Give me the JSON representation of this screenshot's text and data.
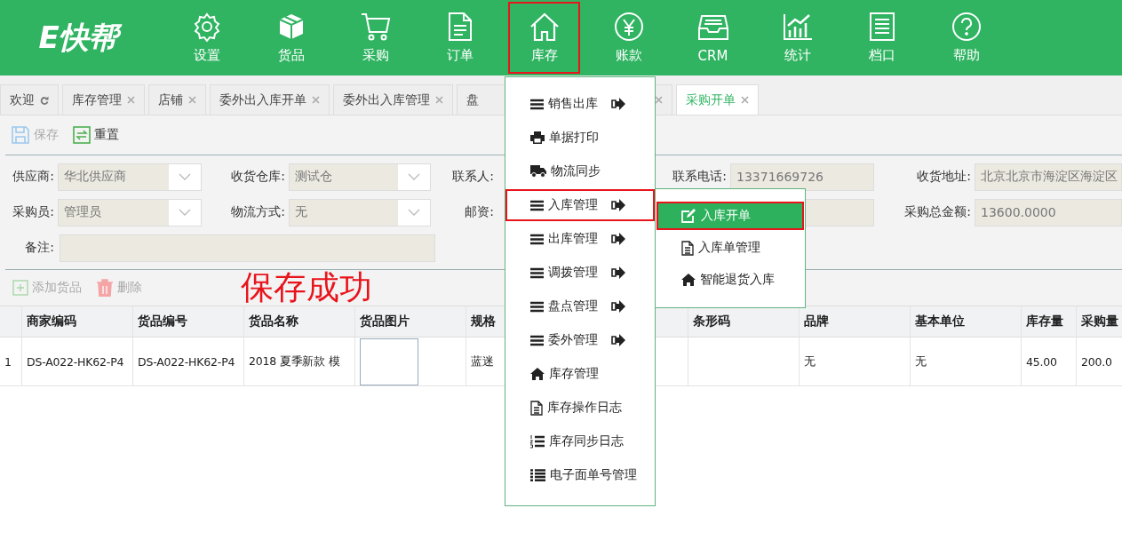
{
  "logo": "E快帮",
  "nav": [
    {
      "label": "设置",
      "kind": "gear",
      "selected": false
    },
    {
      "label": "货品",
      "kind": "box",
      "selected": false
    },
    {
      "label": "采购",
      "kind": "cart",
      "selected": false
    },
    {
      "label": "订单",
      "kind": "doc",
      "selected": false
    },
    {
      "label": "库存",
      "kind": "home",
      "selected": true
    },
    {
      "label": "账款",
      "kind": "yen",
      "selected": false
    },
    {
      "label": "CRM",
      "kind": "tray",
      "selected": false
    },
    {
      "label": "统计",
      "kind": "chart",
      "selected": false
    },
    {
      "label": "档口",
      "kind": "list",
      "selected": false
    },
    {
      "label": "帮助",
      "kind": "help",
      "selected": false
    }
  ],
  "tabs": [
    {
      "label": "欢迎",
      "kind": "refresh",
      "selected": false
    },
    {
      "label": "库存管理",
      "kind": "close",
      "selected": false
    },
    {
      "label": "店铺",
      "kind": "close",
      "selected": false
    },
    {
      "label": "委外出入库开单",
      "kind": "close",
      "selected": false
    },
    {
      "label": "委外出入库管理",
      "kind": "close",
      "selected": false
    },
    {
      "label": "盘",
      "kind": "covered",
      "selected": false
    },
    {
      "label": "采购开单",
      "kind": "close",
      "selected": true
    }
  ],
  "toolbar": [
    {
      "label": "保存",
      "kind": "save",
      "disabled": true
    },
    {
      "label": "重置",
      "kind": "reset",
      "disabled": false
    }
  ],
  "form": {
    "rows": [
      [
        {
          "label": "供应商:",
          "kind": "select",
          "value": "华北供应商"
        },
        {
          "label": "收货仓库:",
          "kind": "select",
          "value": "测试仓"
        },
        {
          "label": "联系人:"
        },
        {
          "label": "联系电话:",
          "kind": "text",
          "value": "13371669726"
        },
        {
          "label": "收货地址:",
          "kind": "text",
          "value": "北京北京市海淀区海淀区"
        }
      ],
      [
        {
          "label": "采购员:",
          "kind": "select",
          "value": "管理员"
        },
        {
          "label": "物流方式:",
          "kind": "select",
          "value": "无"
        },
        {
          "label": "邮资:"
        },
        {
          "kind": "text"
        },
        {
          "label": "采购总金额:",
          "kind": "text",
          "value": "13600.0000"
        }
      ]
    ],
    "remark": {
      "label": "备注:"
    }
  },
  "goods_toolbar": [
    {
      "label": "添加货品",
      "kind": "add",
      "disabled": true
    },
    {
      "label": "删除",
      "kind": "delete",
      "disabled": true
    }
  ],
  "message": "保存成功",
  "table": {
    "columns": [
      "商家编码",
      "货品编号",
      "货品名称",
      "货品图片",
      "规格",
      "条形码",
      "品牌",
      "基本单位",
      "库存量",
      "采购量"
    ],
    "rows": [
      {
        "index": "1",
        "cells": [
          "DS-A022-HK62-P4",
          "DS-A022-HK62-P4",
          "2018 夏季新款 模",
          "",
          "蓝迷",
          "",
          "无",
          "无",
          "45.00",
          "200.0"
        ]
      }
    ]
  },
  "menu": {
    "items": [
      {
        "label": "销售出库",
        "kind": "bars",
        "has_submenu": true,
        "selected": false
      },
      {
        "label": "单据打印",
        "kind": "print",
        "has_submenu": false,
        "selected": false
      },
      {
        "label": "物流同步",
        "kind": "truck",
        "has_submenu": false,
        "selected": false
      },
      {
        "label": "入库管理",
        "kind": "bars",
        "has_submenu": true,
        "selected": true
      },
      {
        "label": "出库管理",
        "kind": "bars",
        "has_submenu": true,
        "selected": false
      },
      {
        "label": "调拨管理",
        "kind": "bars",
        "has_submenu": true,
        "selected": false
      },
      {
        "label": "盘点管理",
        "kind": "bars",
        "has_submenu": true,
        "selected": false
      },
      {
        "label": "委外管理",
        "kind": "bars",
        "has_submenu": true,
        "selected": false
      },
      {
        "label": "库存管理",
        "kind": "home",
        "has_submenu": false,
        "selected": false
      },
      {
        "label": "库存操作日志",
        "kind": "file",
        "has_submenu": false,
        "selected": false
      },
      {
        "label": "库存同步日志",
        "kind": "numbered",
        "has_submenu": false,
        "selected": false
      },
      {
        "label": "电子面单号管理",
        "kind": "list",
        "has_submenu": false,
        "selected": false
      }
    ],
    "submenu": [
      {
        "label": "入库开单",
        "kind": "edit",
        "selected": true
      },
      {
        "label": "入库单管理",
        "kind": "file",
        "selected": false
      },
      {
        "label": "智能退货入库",
        "kind": "home",
        "selected": false
      }
    ]
  }
}
